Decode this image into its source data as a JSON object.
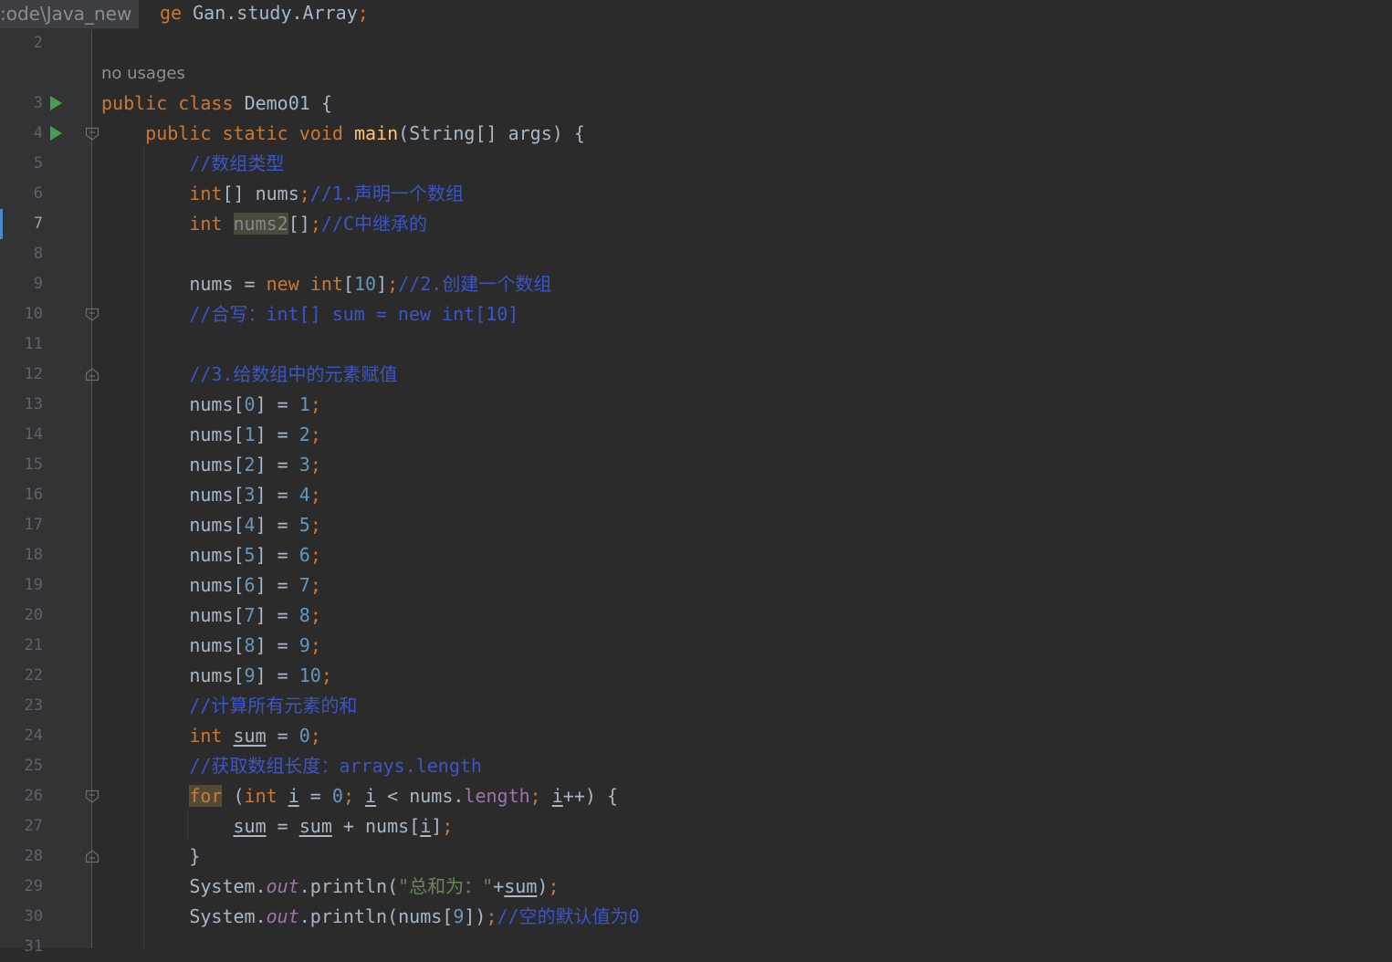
{
  "breadcrumb_path": ":ode\\Java_new",
  "package_line": {
    "kw": "ge",
    "name": "Gan.study.Array",
    "semi": ";"
  },
  "hint_no_usages": "no usages",
  "line_numbers": [
    "2",
    "3",
    "4",
    "5",
    "6",
    "7",
    "8",
    "9",
    "10",
    "11",
    "12",
    "13",
    "14",
    "15",
    "16",
    "17",
    "18",
    "19",
    "20",
    "21",
    "22",
    "23",
    "24",
    "25",
    "26",
    "27",
    "28",
    "29",
    "30",
    "31"
  ],
  "code": {
    "l3": {
      "kw1": "public",
      "kw2": "class",
      "name": "Demo01",
      "brace": " {"
    },
    "l4": {
      "kw1": "public",
      "kw2": "static",
      "kw3": "void",
      "fn": "main",
      "rest": "(String[] args) {"
    },
    "l5": {
      "comment": "//数组类型"
    },
    "l6": {
      "type": "int",
      "rest": "[] nums",
      "semi": ";",
      "comment": "//1.声明一个数组"
    },
    "l7": {
      "type": "int",
      "var": "nums2",
      "rest": "[]",
      "semi": ";",
      "comment": "//C中继承的"
    },
    "l9": {
      "a": "nums = ",
      "kw": "new",
      "sp": " ",
      "type": "int",
      "b": "[",
      "num": "10",
      "c": "]",
      "semi": ";",
      "comment": "//2.创建一个数组"
    },
    "l10": {
      "comment": "//合写：int[] sum = new int[10]"
    },
    "l12": {
      "comment": "//3.给数组中的元素赋值"
    },
    "assign": [
      {
        "a": "nums[",
        "i": "0",
        "b": "] = ",
        "v": "1",
        "semi": ";"
      },
      {
        "a": "nums[",
        "i": "1",
        "b": "] = ",
        "v": "2",
        "semi": ";"
      },
      {
        "a": "nums[",
        "i": "2",
        "b": "] = ",
        "v": "3",
        "semi": ";"
      },
      {
        "a": "nums[",
        "i": "3",
        "b": "] = ",
        "v": "4",
        "semi": ";"
      },
      {
        "a": "nums[",
        "i": "4",
        "b": "] = ",
        "v": "5",
        "semi": ";"
      },
      {
        "a": "nums[",
        "i": "5",
        "b": "] = ",
        "v": "6",
        "semi": ";"
      },
      {
        "a": "nums[",
        "i": "6",
        "b": "] = ",
        "v": "7",
        "semi": ";"
      },
      {
        "a": "nums[",
        "i": "7",
        "b": "] = ",
        "v": "8",
        "semi": ";"
      },
      {
        "a": "nums[",
        "i": "8",
        "b": "] = ",
        "v": "9",
        "semi": ";"
      },
      {
        "a": "nums[",
        "i": "9",
        "b": "] = ",
        "v": "10",
        "semi": ";"
      }
    ],
    "l23": {
      "comment": "//计算所有元素的和"
    },
    "l24": {
      "type": "int",
      "var": "sum",
      "b": " = ",
      "v": "0",
      "semi": ";"
    },
    "l25": {
      "comment": "//获取数组长度：arrays.length"
    },
    "l26": {
      "kw": "for",
      "a": " (",
      "type": "int",
      "sp": " ",
      "i1": "i",
      "b": " = ",
      "v": "0",
      "semi1": ";",
      "sp2": " ",
      "i2": "i",
      "c": " < nums.",
      "fld": "length",
      "semi2": ";",
      "sp3": " ",
      "i3": "i",
      "d": "++) {"
    },
    "l27": {
      "s1": "sum",
      "a": " = ",
      "s2": "sum",
      "b": " + nums[",
      "i": "i",
      "c": "]",
      "semi": ";"
    },
    "l28": {
      "brace": "}"
    },
    "l29": {
      "a": "System.",
      "out": "out",
      "b": ".println(",
      "q1": "\"",
      "str": "总和为：",
      "q2": "\"",
      "c": "+",
      "s": "sum",
      "d": ")",
      "semi": ";"
    },
    "l30": {
      "a": "System.",
      "out": "out",
      "b": ".println(nums[",
      "i": "9",
      "c": "])",
      "semi": ";",
      "comment": "//空的默认值为0"
    }
  }
}
